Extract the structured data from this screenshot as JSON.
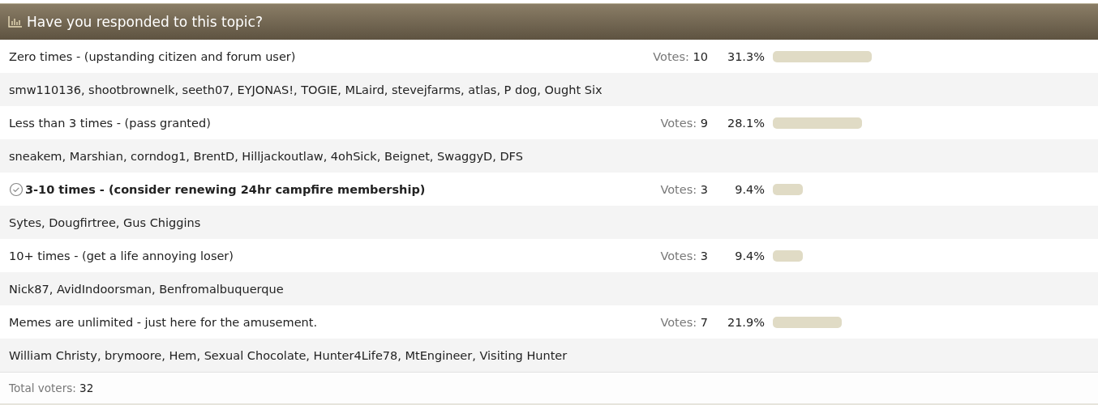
{
  "poll": {
    "title": "Have you responded to this topic?",
    "options": [
      {
        "label": "Zero times - (upstanding citizen and forum user)",
        "selected": false,
        "votes_label": "Votes:",
        "votes": "10",
        "percent": "31.3%",
        "voters": "smw110136, shootbrownelk, seeth07, EYJONAS!, TOGIE, MLaird, stevejfarms, atlas, P dog, Ought Six"
      },
      {
        "label": "Less than 3 times - (pass granted)",
        "selected": false,
        "votes_label": "Votes:",
        "votes": "9",
        "percent": "28.1%",
        "voters": "sneakem, Marshian, corndog1, BrentD, Hilljackoutlaw, 4ohSick, Beignet, SwaggyD, DFS"
      },
      {
        "label": "3-10 times - (consider renewing 24hr campfire membership)",
        "selected": true,
        "votes_label": "Votes:",
        "votes": "3",
        "percent": "9.4%",
        "voters": "Sytes, Dougfirtree, Gus Chiggins"
      },
      {
        "label": "10+ times - (get a life annoying loser)",
        "selected": false,
        "votes_label": "Votes:",
        "votes": "3",
        "percent": "9.4%",
        "voters": "Nick87, AvidIndoorsman, Benfromalbuquerque"
      },
      {
        "label": "Memes are unlimited - just here for the amusement.",
        "selected": false,
        "votes_label": "Votes:",
        "votes": "7",
        "percent": "21.9%",
        "voters": "William Christy, brymoore, Hem, Sexual Chocolate, Hunter4Life78, MtEngineer, Visiting Hunter"
      }
    ],
    "total": {
      "label": "Total voters:",
      "value": "32"
    }
  }
}
